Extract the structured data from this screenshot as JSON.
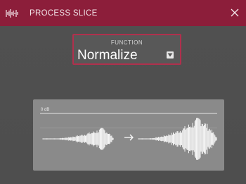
{
  "window": {
    "title": "PROCESS SLICE",
    "logo_icon": "waveform-logo-icon",
    "close_icon": "close-icon"
  },
  "function_selector": {
    "label": "FUNCTION",
    "value": "Normalize",
    "dropdown_icon": "chevron-down-icon"
  },
  "preview": {
    "level_label": "0 dB",
    "arrow_icon": "arrow-right-icon"
  },
  "colors": {
    "titlebar": "#8c1e3a",
    "accent": "#b0304d",
    "background": "#505050",
    "preview_panel": "#8a8a8a",
    "waveform": "#ffffff"
  }
}
